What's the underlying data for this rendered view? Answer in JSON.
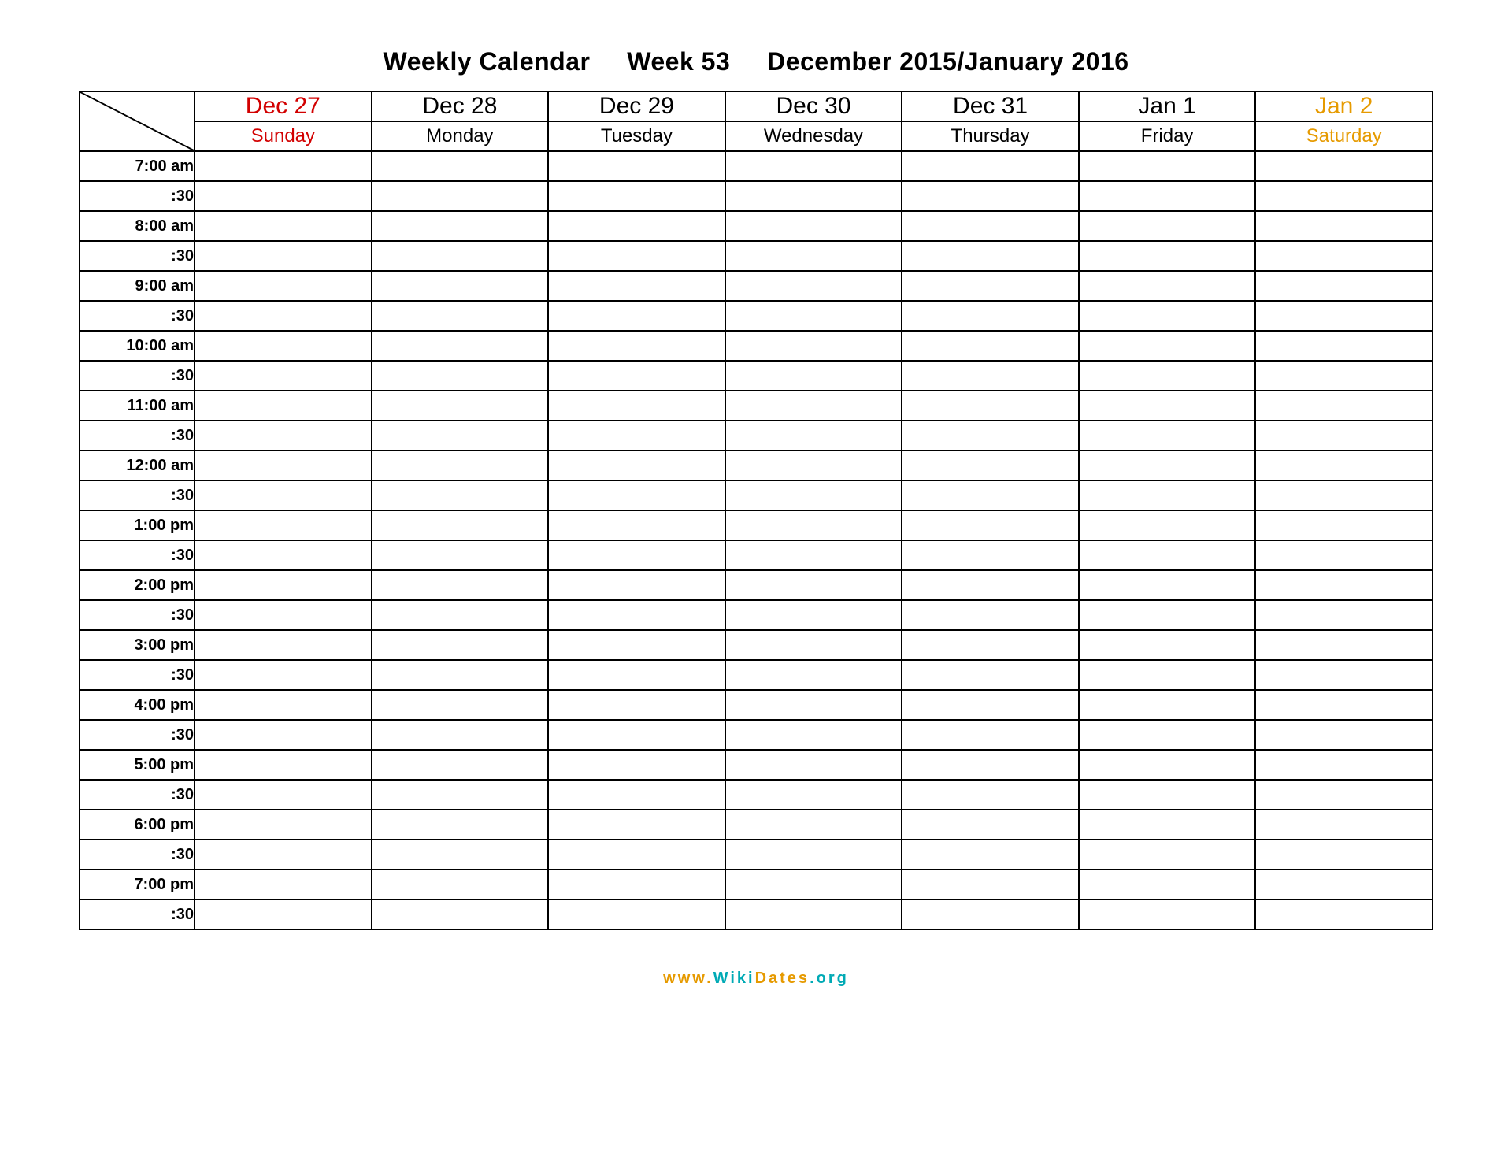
{
  "title": {
    "label": "Weekly Calendar",
    "week": "Week 53",
    "range": "December 2015/January 2016"
  },
  "columns": [
    {
      "date": "Dec 27",
      "day": "Sunday",
      "style": "sunday"
    },
    {
      "date": "Dec 28",
      "day": "Monday",
      "style": ""
    },
    {
      "date": "Dec 29",
      "day": "Tuesday",
      "style": ""
    },
    {
      "date": "Dec 30",
      "day": "Wednesday",
      "style": ""
    },
    {
      "date": "Dec 31",
      "day": "Thursday",
      "style": ""
    },
    {
      "date": "Jan 1",
      "day": "Friday",
      "style": ""
    },
    {
      "date": "Jan 2",
      "day": "Saturday",
      "style": "saturday"
    }
  ],
  "time_slots": [
    "7:00 am",
    ":30",
    "8:00 am",
    ":30",
    "9:00 am",
    ":30",
    "10:00 am",
    ":30",
    "11:00 am",
    ":30",
    "12:00 am",
    ":30",
    "1:00 pm",
    ":30",
    "2:00 pm",
    ":30",
    "3:00 pm",
    ":30",
    "4:00 pm",
    ":30",
    "5:00 pm",
    ":30",
    "6:00 pm",
    ":30",
    "7:00 pm",
    ":30"
  ],
  "footer": {
    "www": "www.",
    "wiki": "Wiki",
    "dates": "Dates",
    "org": ".org"
  }
}
